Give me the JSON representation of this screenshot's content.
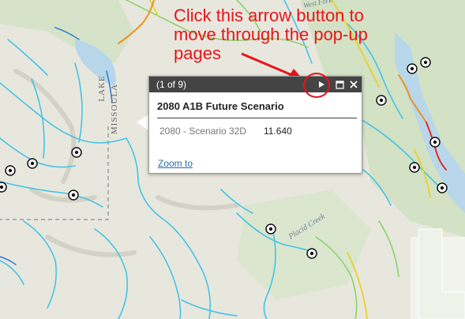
{
  "callout": {
    "line1": "Click this arrow button to",
    "line2": "move through the pop-up",
    "line3": "pages",
    "color": "#e8141b"
  },
  "popup": {
    "count": "(1 of 9)",
    "next_icon": "play-triangle-icon",
    "maximize_icon": "maximize-icon",
    "close_icon": "close-x-icon",
    "title": "2080 A1B Future Scenario",
    "field_label": "2080 - Scenario 32D",
    "field_value": "11.640",
    "zoom_link": "Zoom to"
  },
  "map": {
    "labels": {
      "lake": "LAKE",
      "missoula": "MISSOULA",
      "placid_creek": "Placid Creek",
      "west_fork": "West Fork"
    }
  }
}
